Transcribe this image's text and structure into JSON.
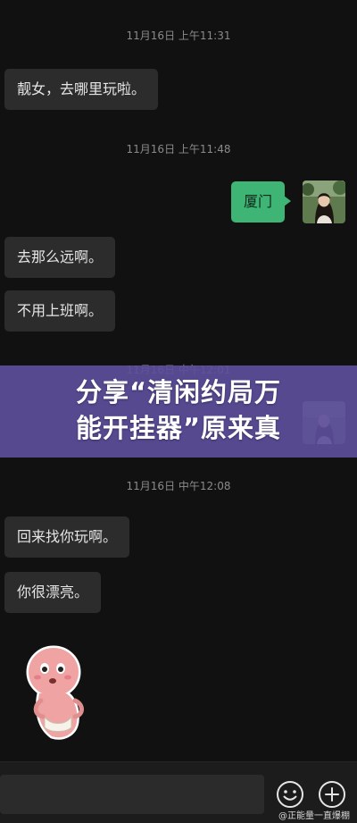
{
  "chat": {
    "messages": [
      {
        "timestamp": "11月16日 上午11:31"
      },
      {
        "text": "靓女，去哪里玩啦。"
      },
      {
        "timestamp": "11月16日 上午11:48"
      },
      {
        "text": "厦门"
      },
      {
        "text": "去那么远啊。"
      },
      {
        "text": "不用上班啊。"
      },
      {
        "timestamp": "11月16日 中午12:01"
      },
      {
        "timestamp": "11月16日 中午12:08"
      },
      {
        "text": "回来找你玩啊。"
      },
      {
        "text": "你很漂亮。"
      }
    ]
  },
  "overlay": {
    "line1": "分享“清闲约局万",
    "line2": "能开挂器”原来真"
  },
  "bottom_bar": {
    "emoji_icon": "smiley-icon",
    "more_icon": "plus-circle-icon",
    "watermark": "@正能量一直爆棚"
  },
  "colors": {
    "background": "#111111",
    "incoming_bubble": "#2c2c2c",
    "outgoing_bubble": "#3eb575",
    "banner": "#5c4e9b"
  }
}
